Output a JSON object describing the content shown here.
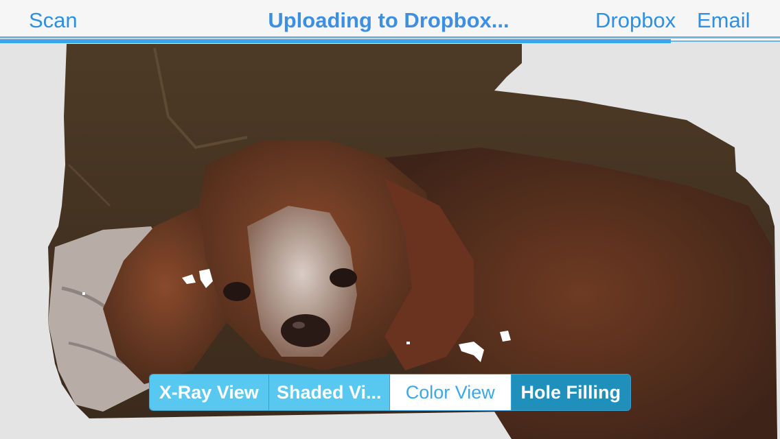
{
  "navbar": {
    "scan_label": "Scan",
    "title": "Uploading to Dropbox...",
    "dropbox_label": "Dropbox",
    "email_label": "Email",
    "upload_progress": 0.86,
    "accent_color": "#2f8fe0"
  },
  "viewport": {
    "content": "3D color scan of a dog lying on a couch",
    "background_color": "#e4e4e4"
  },
  "view_modes": {
    "xray_label": "X-Ray View",
    "shaded_label": "Shaded Vi...",
    "color_label": "Color View",
    "hole_filling_label": "Hole Filling",
    "selected": "Color View",
    "tint_color": "#58c8f0",
    "active_toggle_color": "#1f8fbc"
  }
}
